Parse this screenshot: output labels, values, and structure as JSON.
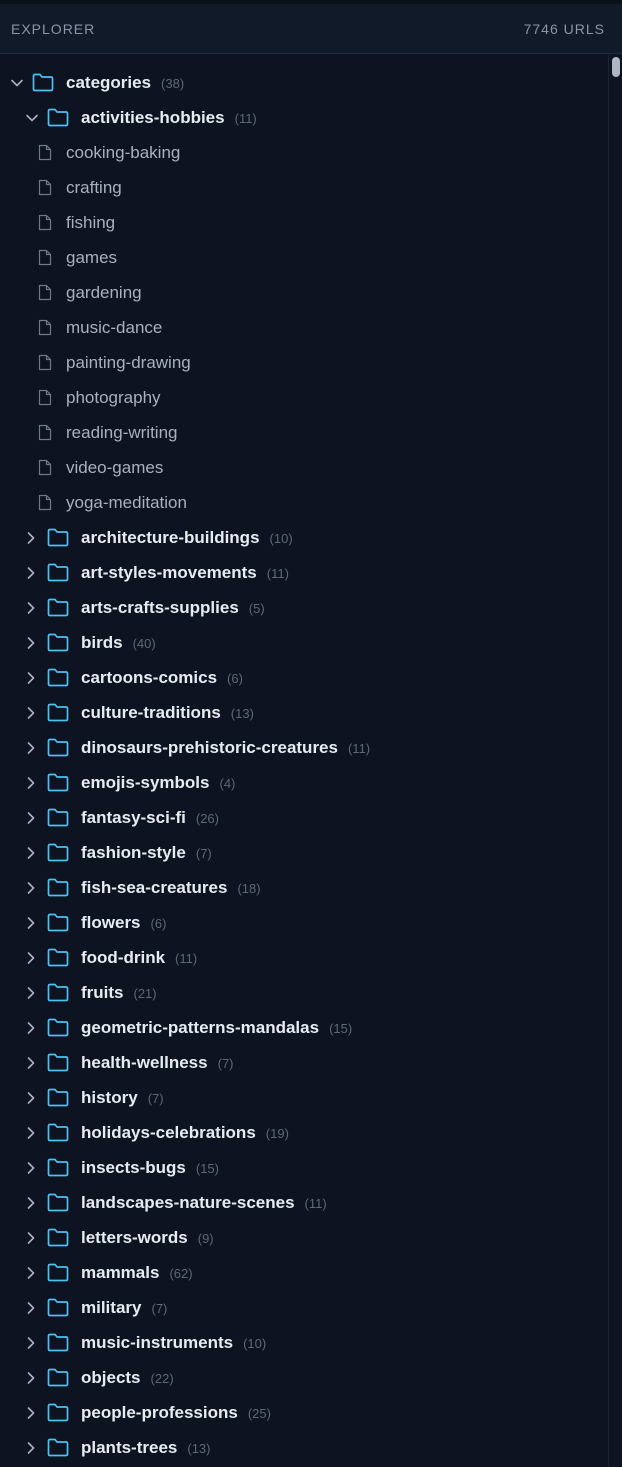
{
  "header": {
    "title": "EXPLORER",
    "count": "7746 URLS"
  },
  "colors": {
    "background": "#0d1320",
    "folder_icon": "#4cc2f2",
    "chevron": "#aab2be",
    "folder_text": "#e8ecf2",
    "file_text": "#a9b1bd",
    "count_text": "#5d6877"
  },
  "root": {
    "name": "categories",
    "count": "(38)",
    "expanded": true,
    "icon": "folder-icon"
  },
  "expanded_folder": {
    "name": "activities-hobbies",
    "count": "(11)",
    "expanded": true,
    "files": [
      "cooking-baking",
      "crafting",
      "fishing",
      "games",
      "gardening",
      "music-dance",
      "painting-drawing",
      "photography",
      "reading-writing",
      "video-games",
      "yoga-meditation"
    ]
  },
  "folders": [
    {
      "name": "architecture-buildings",
      "count": "(10)"
    },
    {
      "name": "art-styles-movements",
      "count": "(11)"
    },
    {
      "name": "arts-crafts-supplies",
      "count": "(5)"
    },
    {
      "name": "birds",
      "count": "(40)"
    },
    {
      "name": "cartoons-comics",
      "count": "(6)"
    },
    {
      "name": "culture-traditions",
      "count": "(13)"
    },
    {
      "name": "dinosaurs-prehistoric-creatures",
      "count": "(11)"
    },
    {
      "name": "emojis-symbols",
      "count": "(4)"
    },
    {
      "name": "fantasy-sci-fi",
      "count": "(26)"
    },
    {
      "name": "fashion-style",
      "count": "(7)"
    },
    {
      "name": "fish-sea-creatures",
      "count": "(18)"
    },
    {
      "name": "flowers",
      "count": "(6)"
    },
    {
      "name": "food-drink",
      "count": "(11)"
    },
    {
      "name": "fruits",
      "count": "(21)"
    },
    {
      "name": "geometric-patterns-mandalas",
      "count": "(15)"
    },
    {
      "name": "health-wellness",
      "count": "(7)"
    },
    {
      "name": "history",
      "count": "(7)"
    },
    {
      "name": "holidays-celebrations",
      "count": "(19)"
    },
    {
      "name": "insects-bugs",
      "count": "(15)"
    },
    {
      "name": "landscapes-nature-scenes",
      "count": "(11)"
    },
    {
      "name": "letters-words",
      "count": "(9)"
    },
    {
      "name": "mammals",
      "count": "(62)"
    },
    {
      "name": "military",
      "count": "(7)"
    },
    {
      "name": "music-instruments",
      "count": "(10)"
    },
    {
      "name": "objects",
      "count": "(22)"
    },
    {
      "name": "people-professions",
      "count": "(25)"
    },
    {
      "name": "plants-trees",
      "count": "(13)"
    }
  ]
}
